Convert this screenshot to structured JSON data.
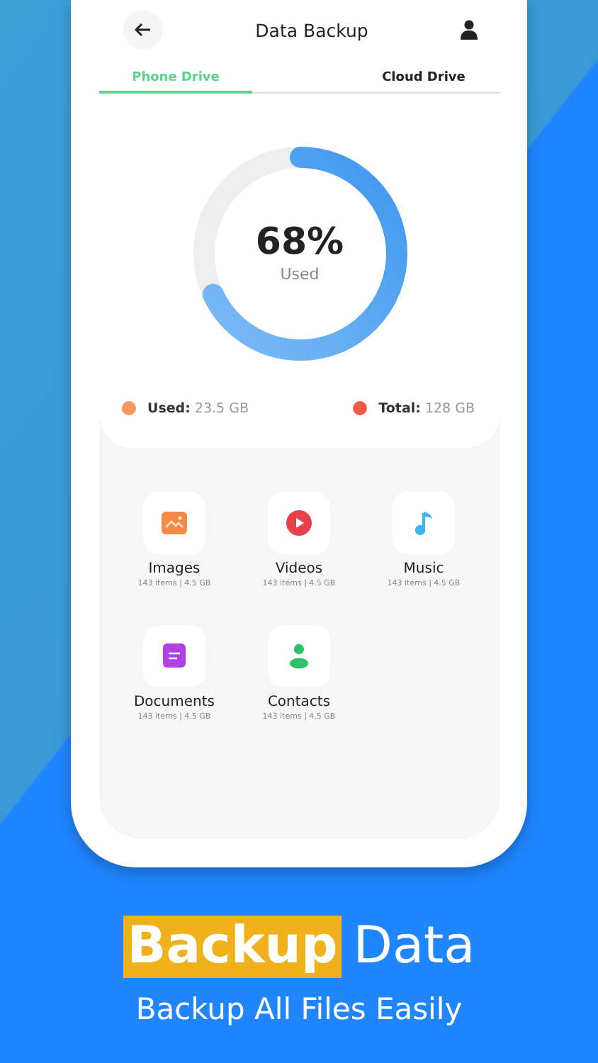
{
  "header": {
    "title": "Data Backup"
  },
  "tabs": [
    {
      "label": "Phone Drive",
      "selected": true
    },
    {
      "label": "Cloud Drive",
      "selected": false
    }
  ],
  "storage": {
    "level": 0.68,
    "percent": "68%",
    "caption": "Used"
  },
  "legend": [
    {
      "label": "Used:",
      "value": "23.5 GB",
      "color": "#f5975a"
    },
    {
      "label": "Total:",
      "value": "128 GB",
      "color": "#ee5c45"
    }
  ],
  "categories": [
    {
      "kind": "image",
      "name": "Images",
      "info": "143 items | 4.5 GB"
    },
    {
      "kind": "video",
      "name": "Videos",
      "info": "143 items | 4.5 GB"
    },
    {
      "kind": "music",
      "name": "Music",
      "info": "143 items | 4.5 GB"
    },
    {
      "kind": "document",
      "name": "Documents",
      "info": "143 items | 4.5 GB"
    },
    {
      "kind": "contact",
      "name": "Contacts",
      "info": "143 items | 4.5 GB"
    }
  ],
  "headline": {
    "highlight": "Backup",
    "rest": "Data"
  },
  "subtitle": "Backup All Files Easily"
}
